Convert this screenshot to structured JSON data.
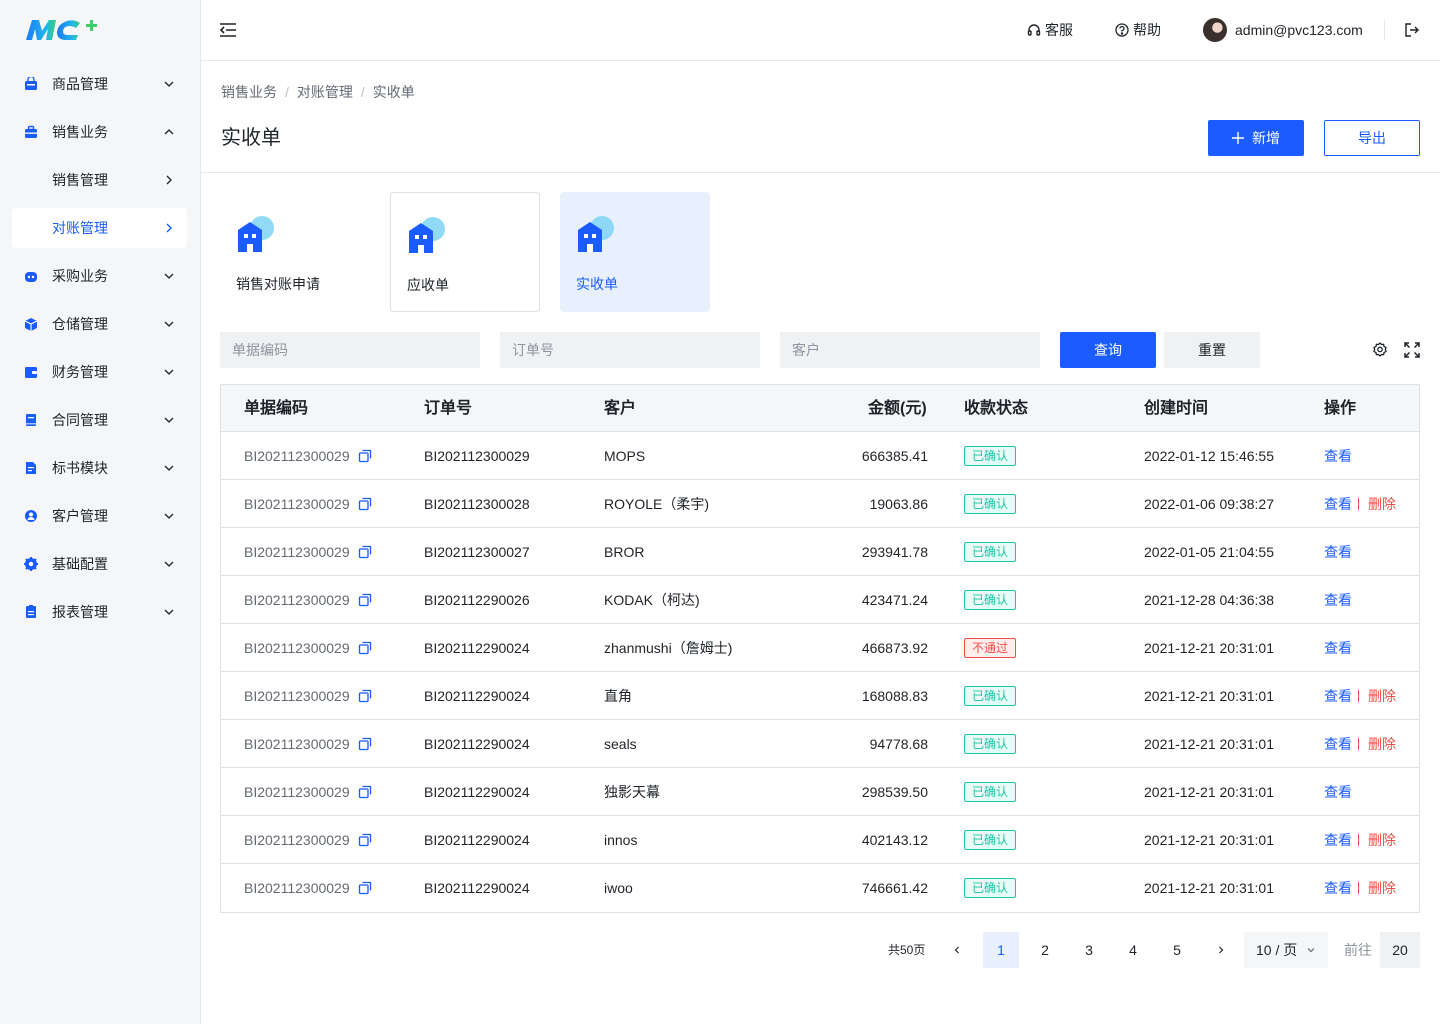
{
  "colors": {
    "primary": "#1a5cff",
    "success": "#14c9a9",
    "danger": "#f54a45"
  },
  "brand": {
    "logo": "MC+"
  },
  "sidebar": {
    "items": [
      {
        "label": "商品管理",
        "icon": "product-icon",
        "expanded": false
      },
      {
        "label": "销售业务",
        "icon": "briefcase-icon",
        "expanded": true
      },
      {
        "label": "销售管理",
        "sub": true
      },
      {
        "label": "对账管理",
        "sub": true,
        "active": true
      },
      {
        "label": "采购业务",
        "icon": "robot-icon",
        "expanded": false
      },
      {
        "label": "仓储管理",
        "icon": "box-icon",
        "expanded": false
      },
      {
        "label": "财务管理",
        "icon": "wallet-icon",
        "expanded": false
      },
      {
        "label": "合同管理",
        "icon": "contract-icon",
        "expanded": false
      },
      {
        "label": "标书模块",
        "icon": "document-icon",
        "expanded": false
      },
      {
        "label": "客户管理",
        "icon": "user-icon",
        "expanded": false
      },
      {
        "label": "基础配置",
        "icon": "gear-icon",
        "expanded": false
      },
      {
        "label": "报表管理",
        "icon": "report-icon",
        "expanded": false
      }
    ]
  },
  "header": {
    "service": "客服",
    "help": "帮助",
    "user": "admin@pvc123.com"
  },
  "breadcrumb": [
    "销售业务",
    "对账管理",
    "实收单"
  ],
  "page": {
    "title": "实收单",
    "add_label": "新增",
    "export_label": "导出"
  },
  "cards": [
    {
      "label": "销售对账申请"
    },
    {
      "label": "应收单"
    },
    {
      "label": "实收单",
      "active": true
    }
  ],
  "filters": {
    "code_placeholder": "单据编码",
    "order_placeholder": "订单号",
    "customer_placeholder": "客户",
    "query_label": "查询",
    "reset_label": "重置"
  },
  "table": {
    "columns": [
      "单据编码",
      "订单号",
      "客户",
      "金额(元)",
      "收款状态",
      "创建时间",
      "操作"
    ],
    "view_label": "查看",
    "delete_label": "删除",
    "rows": [
      {
        "code": "BI202112300029",
        "order": "BI202112300029",
        "customer": "MOPS",
        "amount": "666385.41",
        "status": "已确认",
        "ok": true,
        "time": "2022-01-12 15:46:55",
        "deletable": false
      },
      {
        "code": "BI202112300029",
        "order": "BI202112300028",
        "customer": "ROYOLE（柔宇)",
        "amount": "19063.86",
        "status": "已确认",
        "ok": true,
        "time": "2022-01-06 09:38:27",
        "deletable": true
      },
      {
        "code": "BI202112300029",
        "order": "BI202112300027",
        "customer": "BROR",
        "amount": "293941.78",
        "status": "已确认",
        "ok": true,
        "time": "2022-01-05 21:04:55",
        "deletable": false
      },
      {
        "code": "BI202112300029",
        "order": "BI202112290026",
        "customer": "KODAK（柯达)",
        "amount": "423471.24",
        "status": "已确认",
        "ok": true,
        "time": "2021-12-28 04:36:38",
        "deletable": false
      },
      {
        "code": "BI202112300029",
        "order": "BI202112290024",
        "customer": "zhanmushi（詹姆士)",
        "amount": "466873.92",
        "status": "不通过",
        "ok": false,
        "time": "2021-12-21 20:31:01",
        "deletable": false
      },
      {
        "code": "BI202112300029",
        "order": "BI202112290024",
        "customer": "直角",
        "amount": "168088.83",
        "status": "已确认",
        "ok": true,
        "time": "2021-12-21 20:31:01",
        "deletable": true
      },
      {
        "code": "BI202112300029",
        "order": "BI202112290024",
        "customer": "seals",
        "amount": "94778.68",
        "status": "已确认",
        "ok": true,
        "time": "2021-12-21 20:31:01",
        "deletable": true
      },
      {
        "code": "BI202112300029",
        "order": "BI202112290024",
        "customer": "独影天幕",
        "amount": "298539.50",
        "status": "已确认",
        "ok": true,
        "time": "2021-12-21 20:31:01",
        "deletable": false
      },
      {
        "code": "BI202112300029",
        "order": "BI202112290024",
        "customer": "innos",
        "amount": "402143.12",
        "status": "已确认",
        "ok": true,
        "time": "2021-12-21 20:31:01",
        "deletable": true
      },
      {
        "code": "BI202112300029",
        "order": "BI202112290024",
        "customer": "iwoo",
        "amount": "746661.42",
        "status": "已确认",
        "ok": true,
        "time": "2021-12-21 20:31:01",
        "deletable": true
      }
    ]
  },
  "pagination": {
    "total": "共50页",
    "pages": [
      "1",
      "2",
      "3",
      "4",
      "5"
    ],
    "current": "1",
    "page_size": "10 / 页",
    "goto_label": "前往",
    "goto_value": "20"
  }
}
